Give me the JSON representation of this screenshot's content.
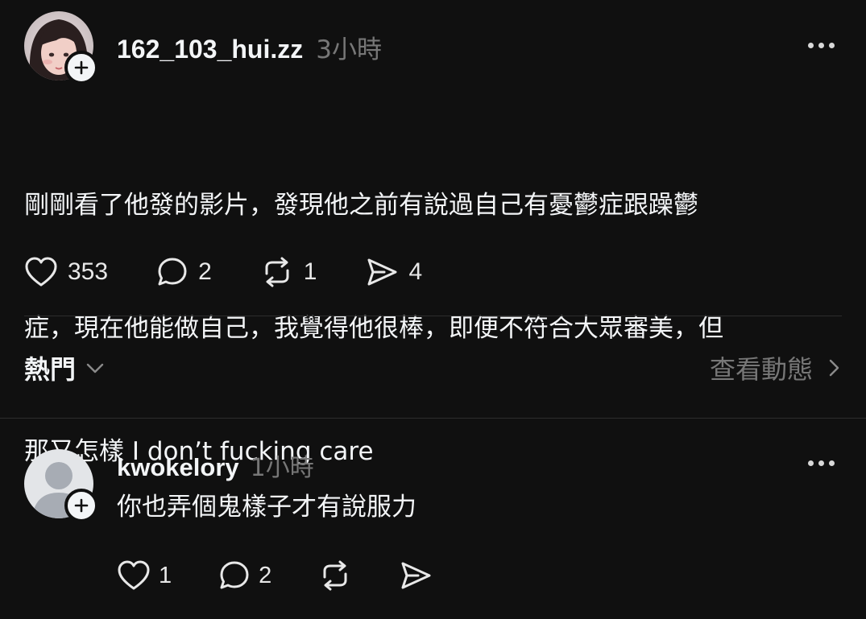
{
  "post": {
    "username": "162_103_hui.zz",
    "timestamp": "3小時",
    "text": "剛剛看了他發的影片，發現他之前有說過自己有憂鬱症跟躁鬱症，現在他能做自己，我覺得他很棒，即便不符合大眾審美，但那又怎樣 I ￼don’t fucking care",
    "text_lines": [
      "剛剛看了他發的影片，發現他之前有說過自己有憂鬱症跟躁鬱",
      "症，現在他能做自己，我覺得他很棒，即便不符合大眾審美，但",
      "那又怎樣 I ￼don’t fucking care"
    ],
    "likes": "353",
    "comments": "2",
    "reposts": "1",
    "shares": "4"
  },
  "sort": {
    "label": "熱門",
    "activity_label": "查看動態"
  },
  "reply": {
    "username": "kwokelory",
    "timestamp": "1小時",
    "text": "你也弄個鬼樣子才有說服力",
    "likes": "1",
    "comments": "2"
  },
  "icons": {
    "like": "heart-icon",
    "comment": "comment-bubble-icon",
    "repost": "repost-arrows-icon",
    "share": "send-icon",
    "more": "more-dots-icon",
    "follow": "plus-icon",
    "sort": "chevron-down-icon",
    "activity": "chevron-right-icon"
  },
  "colors": {
    "background": "#101010",
    "text": "#f3f5f7",
    "muted": "#777777",
    "divider": "#2d2d2d"
  }
}
